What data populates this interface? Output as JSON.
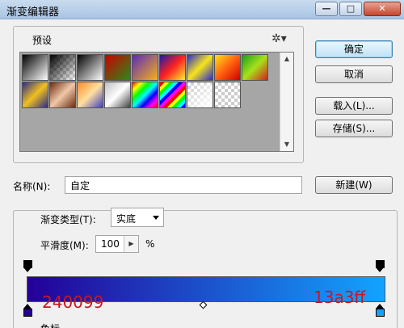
{
  "window": {
    "title": "渐变编辑器",
    "min_glyph": "—",
    "max_glyph": "□",
    "close_glyph": "✕"
  },
  "presets": {
    "label": "预设",
    "gear_glyph": "✲▾",
    "swatches": [
      "linear-gradient(135deg,#000,#fff)",
      "linear-gradient(135deg,#000,rgba(0,0,0,0)),repeating-conic-gradient(#ccc 0 25%,#fff 0 50%) 0 0/8px 8px",
      "linear-gradient(135deg,#000,#fff)",
      "linear-gradient(135deg,#c00,#2a8a1a)",
      "linear-gradient(135deg,#5a2bb8,#f7b01a)",
      "linear-gradient(135deg,#1a1aa8,#ff2020,#ffef2a)",
      "linear-gradient(135deg,#2a2ad0,#f7e51a,#2a2ad0)",
      "linear-gradient(135deg,#ffe21a,#ff6010,#c00)",
      "linear-gradient(135deg,#1aa01a,#a8e01a,#d02020)",
      "linear-gradient(135deg,#2a2a8a,#f0c020,#2a2a8a)",
      "linear-gradient(135deg,#6a2a10,#f0c8a8,#6a2a10)",
      "linear-gradient(135deg,#ff8a2a,#ffe0a0,#4040c0)",
      "linear-gradient(135deg,#c0c0c0,#ffffff,#404040)",
      "linear-gradient(135deg,#f00,#ff0,#0f0,#0ff,#00f,#f0f,#f00)",
      "repeating-linear-gradient(135deg,#f00 0 4px,#ff0 4px 8px,#0f0 8px 12px,#0ff 12px 16px,#00f 16px 20px,#f0f 20px 24px)",
      "linear-gradient(135deg,rgba(255,255,255,0),#fff),repeating-conic-gradient(#ccc 0 25%,#fff 0 50%) 0 0/8px 8px",
      "repeating-conic-gradient(#ccc 0 25%,#fff 0 50%) 0 0/8px 8px"
    ],
    "scroll_up": "▲",
    "scroll_down": "▼"
  },
  "buttons": {
    "ok": "确定",
    "cancel": "取消",
    "load": "载入(L)...",
    "save": "存储(S)...",
    "new": "新建(W)"
  },
  "name": {
    "label": "名称(N):",
    "value": "自定"
  },
  "gradient": {
    "type_label": "渐变类型(T):",
    "type_value": "实底",
    "smoothness_label": "平滑度(M):",
    "smoothness_value": "100",
    "smoothness_spin": "▶",
    "percent": "%",
    "start_color": "#240099",
    "end_color": "#13a3ff",
    "start_hex": "240099",
    "end_hex": "13a3ff",
    "color_label": "色标"
  }
}
